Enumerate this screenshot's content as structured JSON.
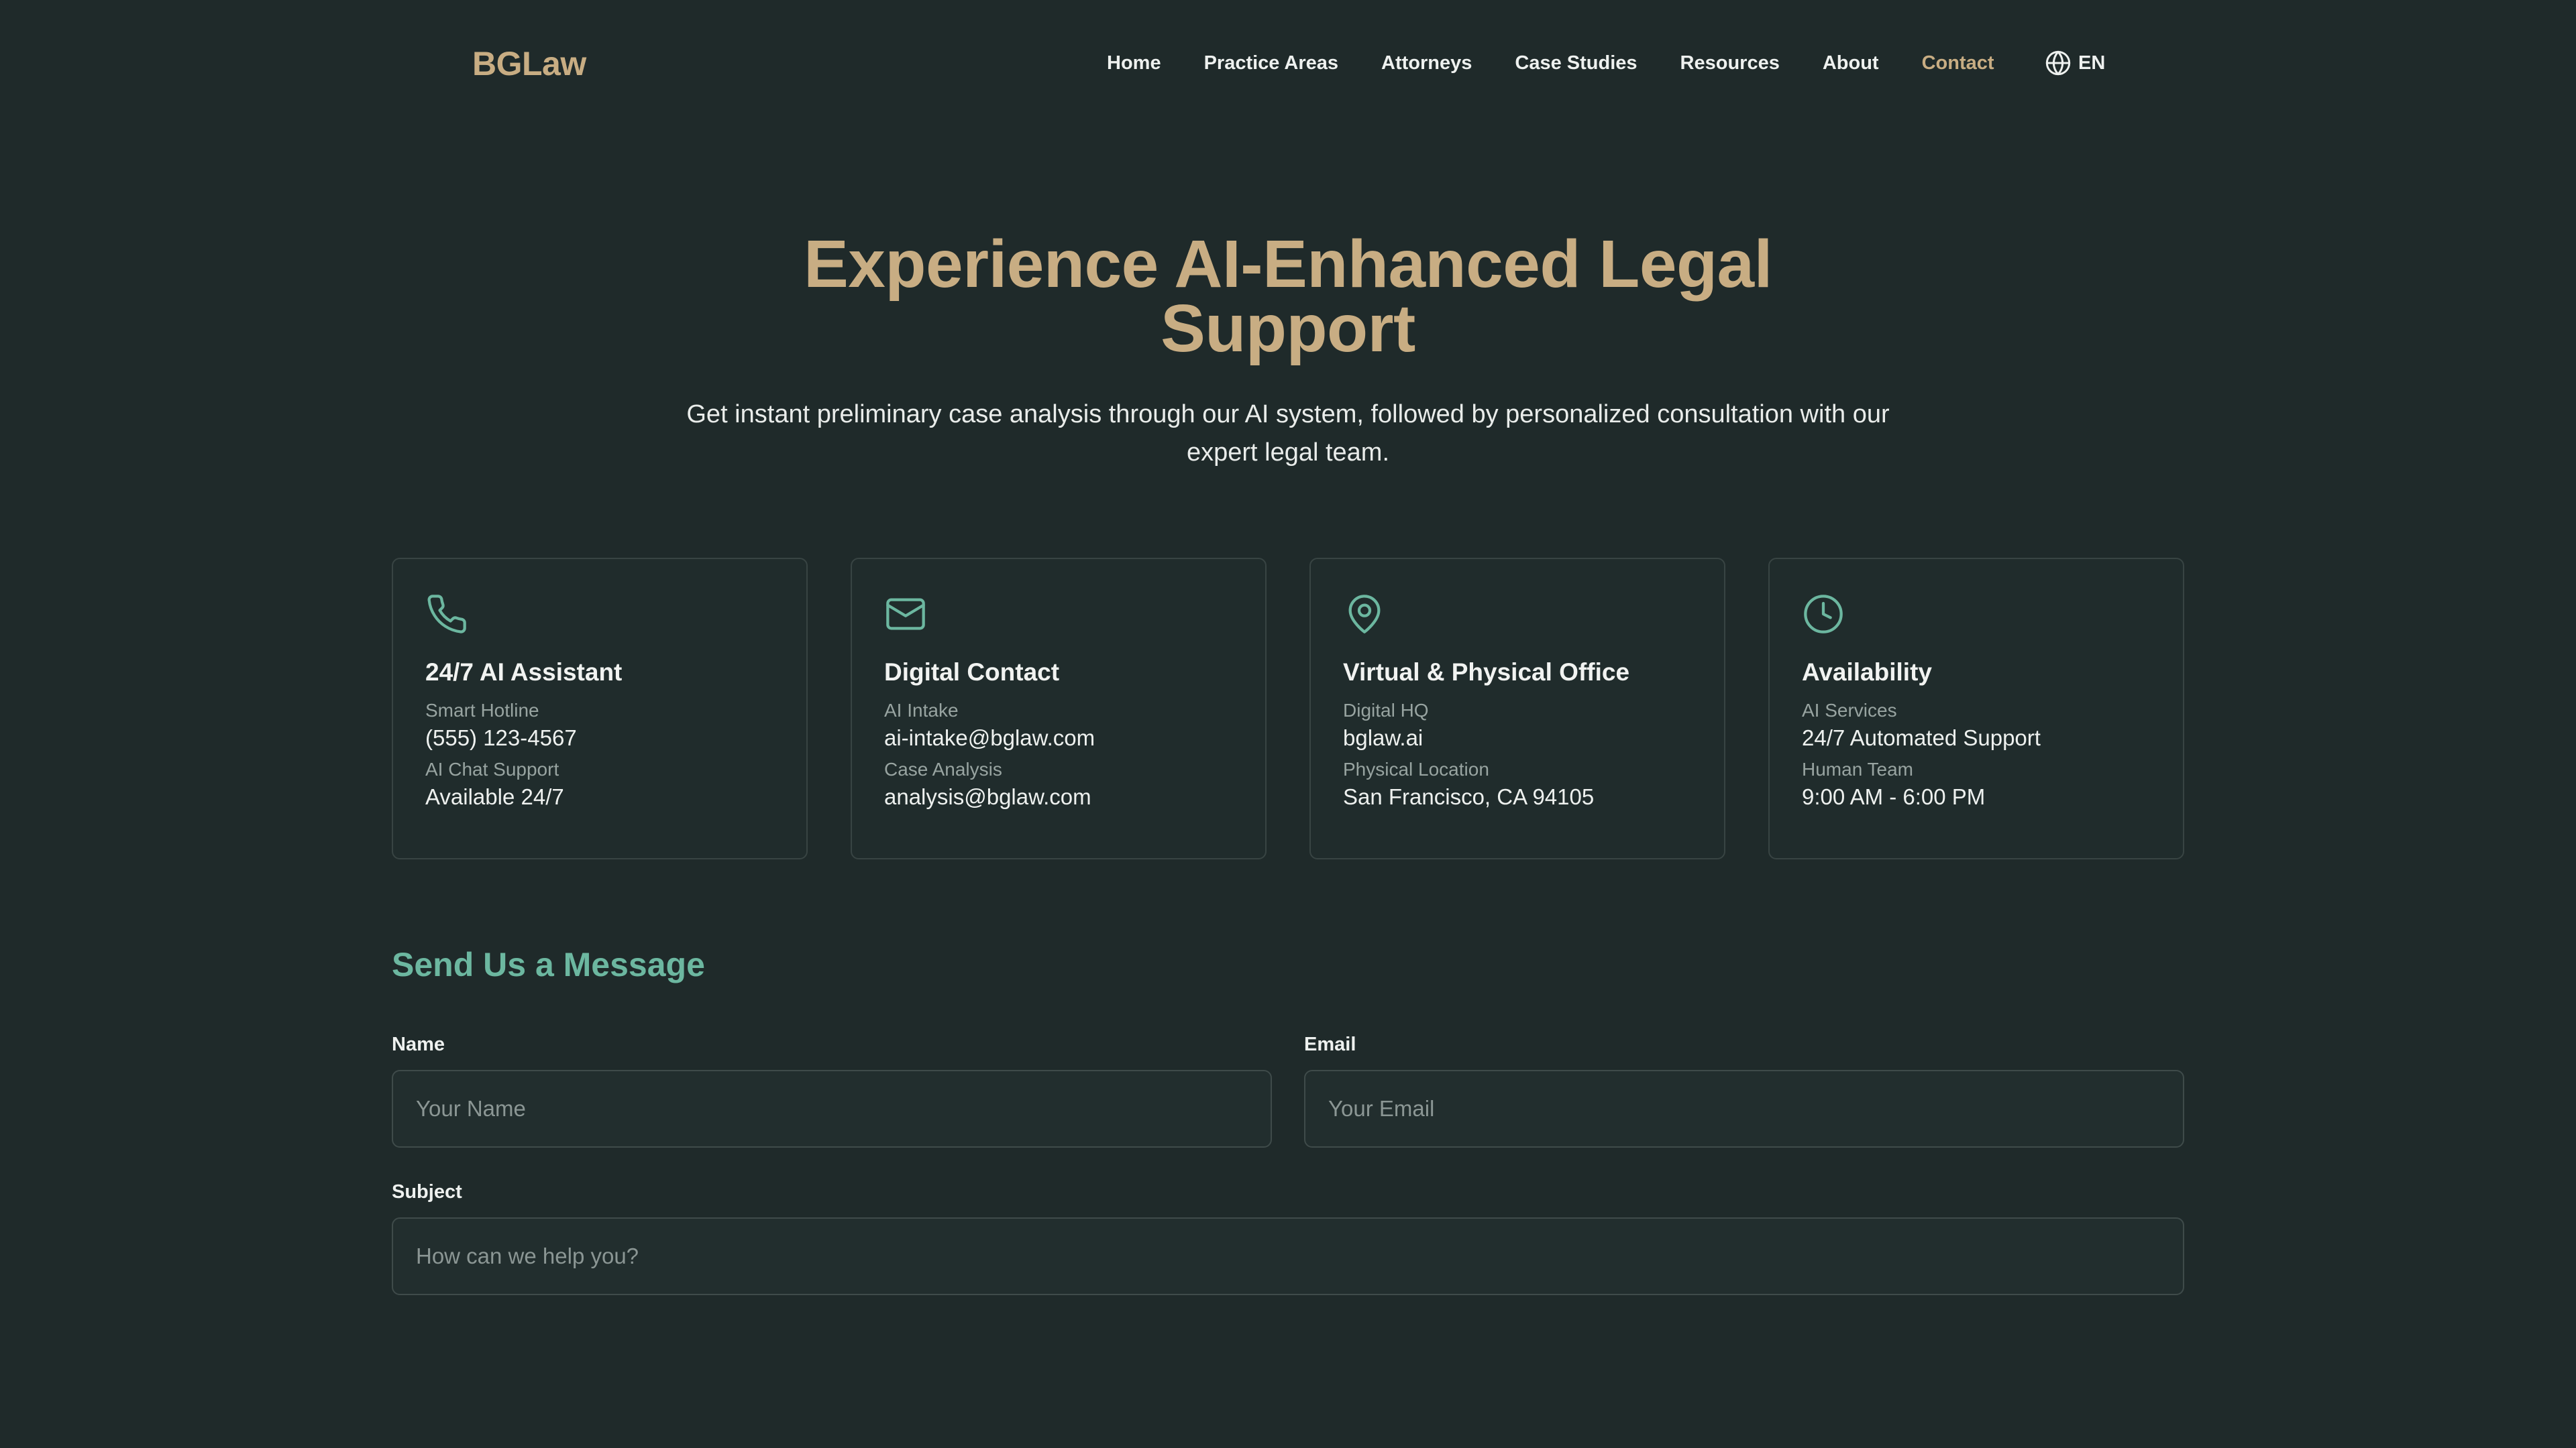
{
  "header": {
    "logo": "BGLaw",
    "nav": [
      {
        "label": "Home",
        "active": false
      },
      {
        "label": "Practice Areas",
        "active": false
      },
      {
        "label": "Attorneys",
        "active": false
      },
      {
        "label": "Case Studies",
        "active": false
      },
      {
        "label": "Resources",
        "active": false
      },
      {
        "label": "About",
        "active": false
      },
      {
        "label": "Contact",
        "active": true
      }
    ],
    "language": {
      "label": "EN",
      "icon": "globe-icon"
    }
  },
  "hero": {
    "title_line1": "Experience AI-Enhanced Legal",
    "title_line2": "Support",
    "subtitle": "Get instant preliminary case analysis through our AI system, followed by personalized consultation with our expert legal team."
  },
  "cards": [
    {
      "icon": "phone-icon",
      "title": "24/7 AI Assistant",
      "label1": "Smart Hotline",
      "value1": "(555) 123-4567",
      "label2": "AI Chat Support",
      "value2": "Available 24/7"
    },
    {
      "icon": "mail-icon",
      "title": "Digital Contact",
      "label1": "AI Intake",
      "value1": "ai-intake@bglaw.com",
      "label2": "Case Analysis",
      "value2": "analysis@bglaw.com"
    },
    {
      "icon": "map-pin-icon",
      "title": "Virtual & Physical Office",
      "label1": "Digital HQ",
      "value1": "bglaw.ai",
      "label2": "Physical Location",
      "value2": "San Francisco, CA 94105"
    },
    {
      "icon": "clock-icon",
      "title": "Availability",
      "label1": "AI Services",
      "value1": "24/7 Automated Support",
      "label2": "Human Team",
      "value2": "9:00 AM - 6:00 PM"
    }
  ],
  "form": {
    "title": "Send Us a Message",
    "name_label": "Name",
    "name_placeholder": "Your Name",
    "email_label": "Email",
    "email_placeholder": "Your Email",
    "subject_label": "Subject",
    "subject_placeholder": "How can we help you?"
  },
  "colors": {
    "background": "#1f2a2a",
    "gold_accent": "#c8ad83",
    "teal_accent": "#6cb7a0",
    "card_border": "#384443"
  }
}
